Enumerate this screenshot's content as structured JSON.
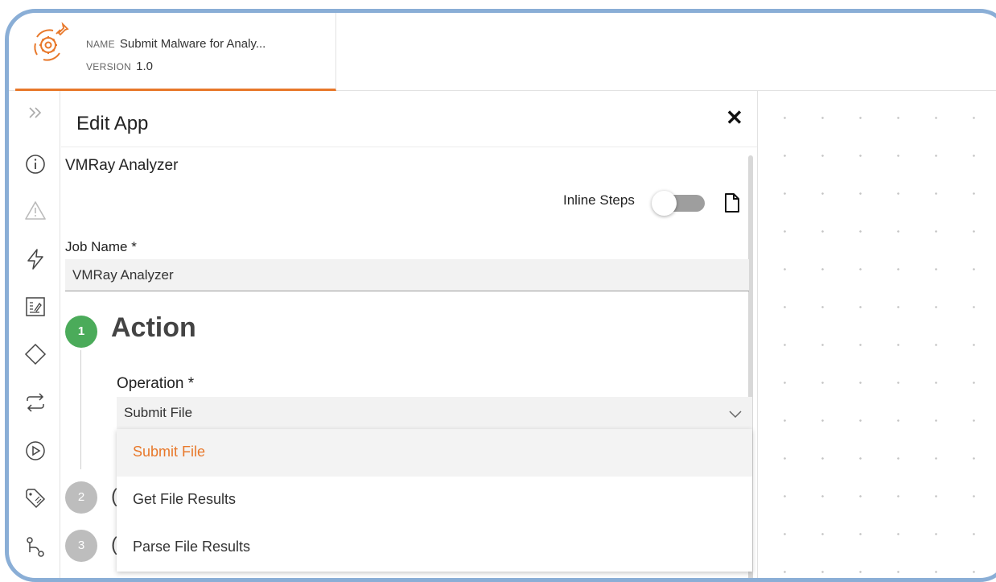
{
  "app": {
    "name_key": "NAME",
    "name_value": "Submit Malware for Analy...",
    "version_key": "VERSION",
    "version_value": "1.0"
  },
  "rail": {
    "icons": [
      "expand-icon",
      "info-icon",
      "warning-icon",
      "lightning-icon",
      "report-icon",
      "diamond-icon",
      "loop-icon",
      "play-icon",
      "tag-icon",
      "branch-icon"
    ]
  },
  "panel": {
    "title": "Edit App",
    "close": "✕",
    "app_name": "VMRay Analyzer",
    "inline_steps_label": "Inline Steps",
    "inline_steps_on": false,
    "job_name_label": "Job Name *",
    "job_name_value": "VMRay Analyzer"
  },
  "steps": [
    {
      "number": "1",
      "title": "Action"
    },
    {
      "number": "2",
      "title": "("
    },
    {
      "number": "3",
      "title": "("
    }
  ],
  "operation": {
    "label": "Operation *",
    "value": "Submit File",
    "options": [
      "Submit File",
      "Get File Results",
      "Parse File Results"
    ],
    "selected_index": 0
  },
  "colors": {
    "accent": "#e8782a",
    "step_active": "#4bab5a",
    "step_inactive": "#bdbdbd",
    "frame": "#8aaed6"
  }
}
